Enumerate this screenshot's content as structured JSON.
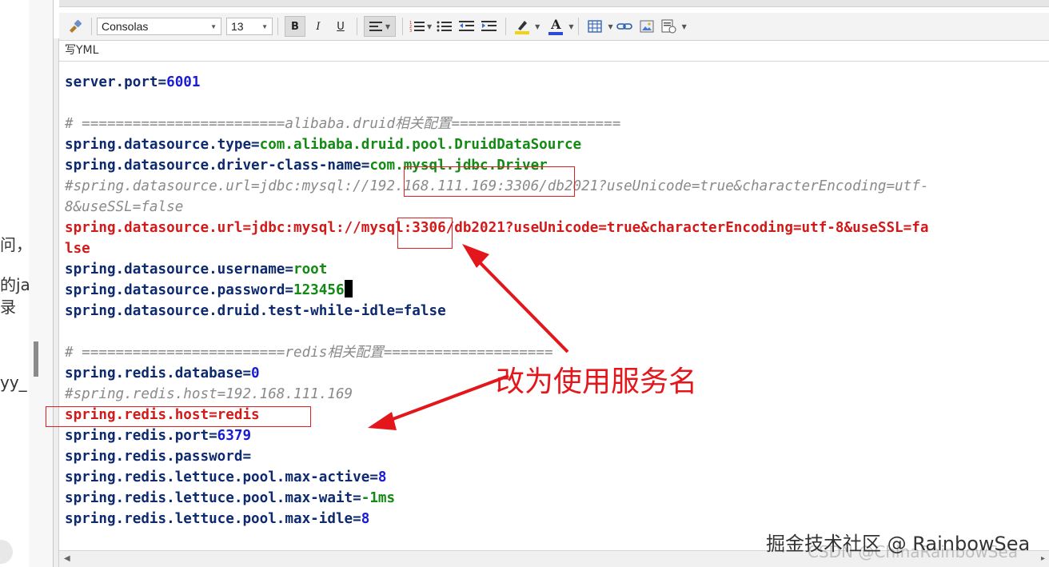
{
  "left_page": {
    "fragments": [
      "问，",
      "的ja",
      "录",
      "yy_"
    ]
  },
  "toolbar": {
    "font_family": "Consolas",
    "font_size": "13",
    "bold_label": "B",
    "italic_label": "I",
    "underline_label": "U",
    "highlight_color": "#f1d313",
    "font_color": "#2a4bd7",
    "font_color_label": "A"
  },
  "editor": {
    "file_label": "写YML",
    "lines": [
      {
        "type": "kv",
        "key": "server.port=",
        "value": "6001",
        "vclass": "v-num"
      },
      {
        "type": "blank"
      },
      {
        "type": "comment",
        "text": "# ========================alibaba.druid相关配置===================="
      },
      {
        "type": "kv",
        "key": "spring.datasource.type=",
        "value": "com.alibaba.druid.pool.DruidDataSource",
        "vclass": "v-str"
      },
      {
        "type": "kv",
        "key": "spring.datasource.driver-class-name=",
        "value": "com.mysql.jdbc.Driver",
        "vclass": "v-str"
      },
      {
        "type": "comment",
        "text": "#spring.datasource.url=jdbc:mysql://192.168.111.169:3306/db2021?useUnicode=true&characterEncoding=utf-"
      },
      {
        "type": "comment",
        "text": "8&useSSL=false"
      },
      {
        "type": "red",
        "text": "spring.datasource.url=jdbc:mysql://mysql:3306/db2021?useUnicode=true&characterEncoding=utf-8&useSSL=fa"
      },
      {
        "type": "red",
        "text": "lse"
      },
      {
        "type": "kv",
        "key": "spring.datasource.username=",
        "value": "root",
        "vclass": "v-str"
      },
      {
        "type": "kv",
        "key": "spring.datasource.password=",
        "value": "123456",
        "vclass": "v-str",
        "cursor": true
      },
      {
        "type": "kv",
        "key": "spring.datasource.druid.test-while-idle=",
        "value": "false",
        "vclass": "v-plain"
      },
      {
        "type": "blank"
      },
      {
        "type": "comment",
        "text": "# ========================redis相关配置===================="
      },
      {
        "type": "kv",
        "key": "spring.redis.database=",
        "value": "0",
        "vclass": "v-num"
      },
      {
        "type": "comment",
        "text": "#spring.redis.host=192.168.111.169"
      },
      {
        "type": "red",
        "text": "spring.redis.host=redis"
      },
      {
        "type": "kv",
        "key": "spring.redis.port=",
        "value": "6379",
        "vclass": "v-num"
      },
      {
        "type": "kv",
        "key": "spring.redis.password=",
        "value": "",
        "vclass": "v-plain"
      },
      {
        "type": "kv",
        "key": "spring.redis.lettuce.pool.max-active=",
        "value": "8",
        "vclass": "v-num"
      },
      {
        "type": "kv",
        "key": "spring.redis.lettuce.pool.max-wait=",
        "value": "-1ms",
        "vclass": "v-str"
      },
      {
        "type": "kv",
        "key": "spring.redis.lettuce.pool.max-idle=",
        "value": "8",
        "vclass": "v-num"
      }
    ]
  },
  "annotation": {
    "text": "改为使用服务名",
    "color": "#e3171b"
  },
  "watermark": {
    "text": "掘金技术社区 @ RainbowSea",
    "secondary": "CSDN @ChinaRainbowSea"
  }
}
